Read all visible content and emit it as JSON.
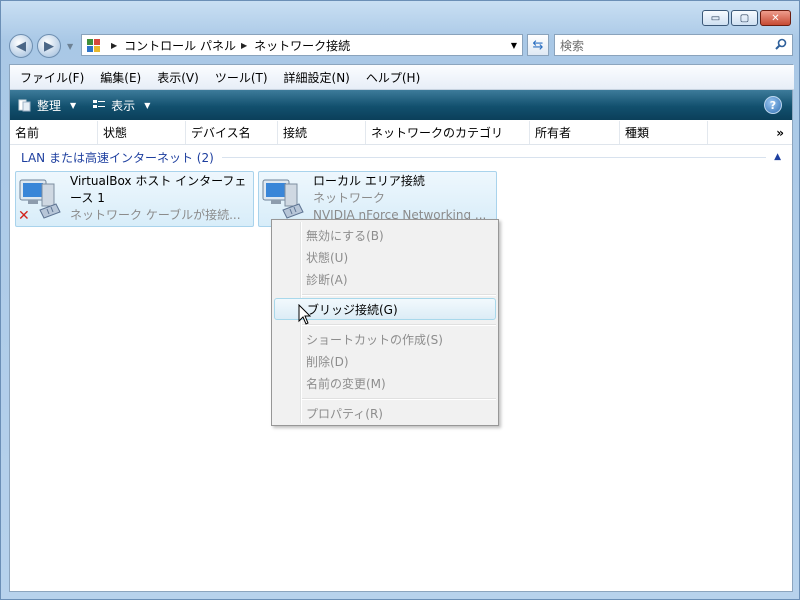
{
  "window": {
    "caption_buttons": {
      "minimize": "▭",
      "maximize": "▢",
      "close": "✕"
    }
  },
  "nav": {
    "breadcrumb": [
      "コントロール パネル",
      "ネットワーク接続"
    ],
    "search_placeholder": "検索"
  },
  "menubar": {
    "items": [
      "ファイル(F)",
      "編集(E)",
      "表示(V)",
      "ツール(T)",
      "詳細設定(N)",
      "ヘルプ(H)"
    ]
  },
  "toolbar": {
    "organize_label": "整理",
    "view_label": "表示",
    "help_label": "?"
  },
  "columns": [
    "名前",
    "状態",
    "デバイス名",
    "接続",
    "ネットワークのカテゴリ",
    "所有者",
    "種類"
  ],
  "columns_more": "»",
  "group": {
    "title": "LAN または高速インターネット (2)"
  },
  "connections": [
    {
      "name_line1": "VirtualBox ホスト インターフェ",
      "name_line2": "ース 1",
      "status": "ネットワーク ケーブルが接続...",
      "disconnected": true
    },
    {
      "name_line1": "ローカル エリア接続",
      "status": "ネットワーク",
      "device": "NVIDIA nForce Networking ...",
      "disconnected": false
    }
  ],
  "context_menu": {
    "items": [
      {
        "label": "無効にする(B)",
        "enabled": false
      },
      {
        "label": "状態(U)",
        "enabled": false
      },
      {
        "label": "診断(A)",
        "enabled": false
      },
      {
        "label": "ブリッジ接続(G)",
        "enabled": true,
        "highlighted": true
      },
      {
        "label": "ショートカットの作成(S)",
        "enabled": false
      },
      {
        "label": "削除(D)",
        "enabled": false
      },
      {
        "label": "名前の変更(M)",
        "enabled": false
      },
      {
        "label": "プロパティ(R)",
        "enabled": false
      }
    ]
  },
  "colors": {
    "toolbar": "#12506e",
    "group_header": "#1e3f9f",
    "selection_border": "#a9d3ec",
    "disabled_text": "#8d8d8d"
  }
}
